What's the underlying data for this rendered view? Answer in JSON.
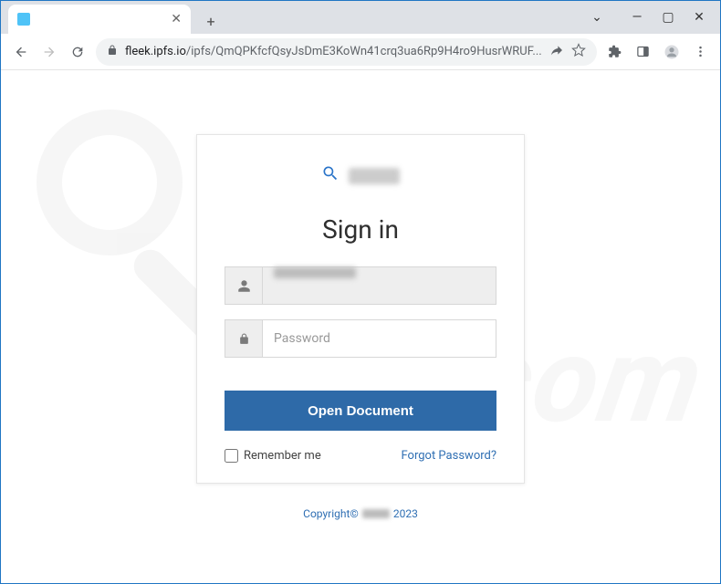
{
  "window": {
    "controls": {
      "minimize": "—",
      "maximize": "▢",
      "close": "✕",
      "dropdown": "⌄"
    }
  },
  "tabs": [
    {
      "title": "   ",
      "close": "✕"
    }
  ],
  "newTab": "+",
  "toolbar": {
    "url_host": "fleek.ipfs.io",
    "url_path": "/ipfs/QmQPKfcfQsyJsDmE3KoWn41crq3ua6Rp9H4ro9HusrWRUF..."
  },
  "login": {
    "brand_text": "",
    "heading": "Sign in",
    "email_value": "",
    "password_placeholder": "Password",
    "submit_label": "Open Document",
    "remember_label": "Remember me",
    "forgot_label": "Forgot Password?"
  },
  "footer": {
    "copyright_prefix": "Copyright©",
    "copyright_year": "2023"
  },
  "watermark_text": "risk.com"
}
